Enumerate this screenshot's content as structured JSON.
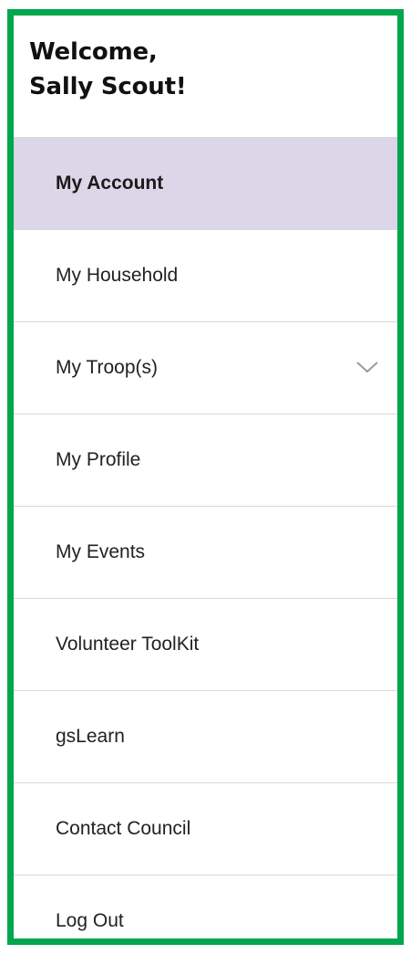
{
  "welcome": {
    "line1": "Welcome,",
    "line2": "Sally Scout!"
  },
  "menu": {
    "items": [
      {
        "label": "My Account",
        "active": true
      },
      {
        "label": "My Household"
      },
      {
        "label": "My Troop(s)",
        "icon": "chevron-down-icon"
      },
      {
        "label": "My Profile"
      },
      {
        "label": "My Events"
      },
      {
        "label": "Volunteer ToolKit"
      },
      {
        "label": "gsLearn"
      },
      {
        "label": "Contact Council"
      },
      {
        "label": "Log Out"
      }
    ]
  },
  "colors": {
    "border": "#00a74e",
    "active_bg": "#dcd6e8",
    "divider": "#d9d9d9"
  }
}
